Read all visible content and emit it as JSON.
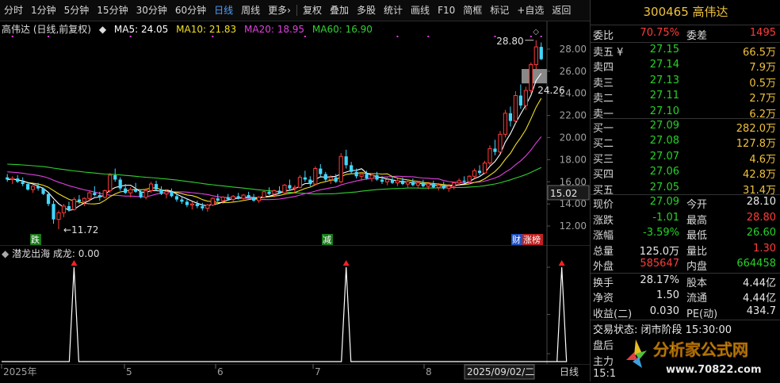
{
  "toolbar": {
    "items": [
      "分时",
      "1分钟",
      "5分钟",
      "15分钟",
      "30分钟",
      "60分钟",
      "日线",
      "周线",
      "更多",
      "复权",
      "叠加",
      "多股",
      "统计",
      "画线",
      "F10",
      "简框",
      "标记",
      "+自选",
      "返回"
    ],
    "active_index": 6
  },
  "legend": {
    "title": "高伟达 (日线,前复权)",
    "ma5": "MA5: 24.05",
    "ma10": "MA10: 21.83",
    "ma20": "MA20: 18.95",
    "ma60": "MA60: 16.90",
    "colors": {
      "ma5": "#ffffff",
      "ma10": "#f0e020",
      "ma20": "#e040e0",
      "ma60": "#30d030"
    }
  },
  "indicator_legend": {
    "name": "潜龙出海",
    "value": "成龙: 0.00"
  },
  "price_axis": {
    "ticks": [
      "28.00",
      "26.00",
      "24.00",
      "22.00",
      "20.00",
      "18.00",
      "16.00",
      "14.00",
      "12.00"
    ],
    "current": "15.02"
  },
  "annotations": {
    "high": "28.80",
    "high_flag": "24.26",
    "low": "←11.72",
    "tag_drop": "跌",
    "tag_reduce": "减",
    "tag_fin": "财",
    "tag_rank": "涨榜"
  },
  "time_axis": {
    "labels": [
      "2025年",
      "5",
      "6",
      "7",
      "8"
    ],
    "cursor_date": "2025/09/02/二",
    "period": "日线"
  },
  "chart_data": {
    "type": "candlestick",
    "title": "高伟达 (日线,前复权)",
    "ylim": [
      11,
      29.5
    ],
    "ohlc": [
      [
        16.4,
        16.7,
        16.0,
        16.2
      ],
      [
        16.2,
        16.5,
        15.8,
        16.3
      ],
      [
        16.3,
        16.6,
        15.9,
        16.0
      ],
      [
        16.0,
        16.4,
        15.6,
        15.8
      ],
      [
        15.8,
        16.0,
        15.2,
        15.3
      ],
      [
        15.3,
        15.7,
        15.0,
        15.6
      ],
      [
        15.6,
        15.9,
        15.2,
        15.4
      ],
      [
        15.4,
        15.5,
        14.8,
        14.9
      ],
      [
        14.9,
        15.0,
        13.8,
        14.0
      ],
      [
        14.0,
        14.3,
        12.2,
        12.6
      ],
      [
        12.6,
        13.4,
        11.72,
        13.2
      ],
      [
        13.2,
        14.0,
        12.8,
        13.8
      ],
      [
        13.8,
        14.2,
        13.3,
        13.5
      ],
      [
        13.5,
        14.6,
        13.4,
        14.4
      ],
      [
        14.4,
        14.8,
        14.0,
        14.2
      ],
      [
        14.2,
        14.6,
        13.8,
        14.5
      ],
      [
        14.5,
        15.2,
        14.2,
        15.0
      ],
      [
        15.0,
        15.6,
        14.7,
        14.8
      ],
      [
        14.8,
        15.1,
        14.3,
        14.6
      ],
      [
        14.6,
        15.3,
        14.5,
        15.2
      ],
      [
        15.2,
        16.8,
        15.0,
        16.6
      ],
      [
        16.6,
        17.2,
        16.0,
        16.2
      ],
      [
        16.2,
        16.4,
        15.2,
        15.4
      ],
      [
        15.4,
        15.8,
        14.9,
        15.0
      ],
      [
        15.0,
        15.5,
        14.6,
        15.3
      ],
      [
        15.3,
        15.9,
        15.0,
        15.1
      ],
      [
        15.1,
        15.3,
        14.5,
        14.6
      ],
      [
        14.6,
        15.4,
        14.4,
        15.2
      ],
      [
        15.2,
        16.0,
        15.0,
        15.8
      ],
      [
        15.8,
        16.1,
        15.2,
        15.3
      ],
      [
        15.3,
        15.6,
        14.8,
        14.9
      ],
      [
        14.9,
        15.3,
        14.5,
        15.1
      ],
      [
        15.1,
        15.4,
        14.6,
        14.7
      ],
      [
        14.7,
        15.0,
        14.2,
        14.4
      ],
      [
        14.4,
        14.7,
        14.0,
        14.2
      ],
      [
        14.2,
        14.5,
        13.7,
        13.9
      ],
      [
        13.9,
        14.2,
        13.5,
        14.0
      ],
      [
        14.0,
        14.3,
        13.6,
        13.8
      ],
      [
        13.8,
        14.1,
        13.4,
        13.6
      ],
      [
        13.6,
        14.0,
        13.3,
        13.9
      ],
      [
        13.9,
        14.6,
        13.8,
        14.5
      ],
      [
        14.5,
        14.9,
        14.2,
        14.3
      ],
      [
        14.3,
        14.7,
        14.0,
        14.6
      ],
      [
        14.6,
        14.9,
        14.3,
        14.4
      ],
      [
        14.4,
        14.8,
        14.2,
        14.7
      ],
      [
        14.7,
        15.0,
        14.4,
        14.5
      ],
      [
        14.5,
        14.9,
        14.3,
        14.8
      ],
      [
        14.8,
        15.1,
        14.5,
        14.6
      ],
      [
        14.6,
        14.9,
        14.2,
        14.3
      ],
      [
        14.3,
        14.7,
        14.1,
        14.6
      ],
      [
        14.6,
        15.2,
        14.5,
        15.1
      ],
      [
        15.1,
        15.5,
        14.8,
        14.9
      ],
      [
        14.9,
        15.3,
        14.6,
        15.2
      ],
      [
        15.2,
        15.6,
        14.9,
        15.0
      ],
      [
        15.0,
        15.8,
        14.9,
        15.7
      ],
      [
        15.7,
        16.2,
        15.3,
        15.4
      ],
      [
        15.4,
        15.7,
        15.0,
        15.5
      ],
      [
        15.5,
        16.6,
        15.4,
        16.4
      ],
      [
        16.4,
        17.0,
        16.0,
        16.2
      ],
      [
        16.2,
        16.5,
        15.6,
        15.8
      ],
      [
        15.8,
        17.4,
        15.7,
        17.2
      ],
      [
        17.2,
        17.6,
        16.5,
        16.7
      ],
      [
        16.7,
        16.9,
        16.0,
        16.2
      ],
      [
        16.2,
        16.6,
        15.8,
        16.4
      ],
      [
        16.4,
        16.7,
        15.9,
        16.0
      ],
      [
        16.0,
        18.6,
        15.9,
        18.3
      ],
      [
        18.3,
        18.9,
        17.2,
        17.5
      ],
      [
        17.5,
        17.8,
        16.7,
        16.9
      ],
      [
        16.9,
        17.2,
        16.3,
        16.5
      ],
      [
        16.5,
        16.9,
        16.1,
        16.7
      ],
      [
        16.7,
        17.0,
        16.2,
        16.3
      ],
      [
        16.3,
        16.8,
        16.0,
        16.6
      ],
      [
        16.6,
        16.9,
        16.1,
        16.2
      ],
      [
        16.2,
        16.5,
        15.8,
        16.0
      ],
      [
        16.0,
        16.4,
        15.7,
        16.2
      ],
      [
        16.2,
        16.5,
        15.8,
        15.9
      ],
      [
        15.9,
        16.3,
        15.6,
        16.1
      ],
      [
        16.1,
        16.4,
        15.7,
        15.8
      ],
      [
        15.8,
        16.2,
        15.5,
        16.0
      ],
      [
        16.0,
        16.3,
        15.6,
        15.7
      ],
      [
        15.7,
        16.1,
        15.4,
        15.9
      ],
      [
        15.9,
        16.2,
        15.5,
        15.6
      ],
      [
        15.6,
        16.0,
        15.3,
        15.8
      ],
      [
        15.8,
        16.1,
        15.4,
        15.5
      ],
      [
        15.5,
        15.9,
        15.2,
        15.7
      ],
      [
        15.7,
        16.0,
        15.3,
        15.4
      ],
      [
        15.4,
        15.8,
        15.1,
        15.6
      ],
      [
        15.6,
        16.0,
        15.3,
        15.9
      ],
      [
        15.9,
        16.3,
        15.6,
        16.1
      ],
      [
        16.1,
        16.5,
        15.8,
        16.0
      ],
      [
        16.0,
        16.6,
        15.8,
        16.5
      ],
      [
        16.5,
        17.2,
        16.3,
        17.0
      ],
      [
        17.0,
        17.5,
        16.6,
        16.8
      ],
      [
        16.8,
        17.9,
        16.7,
        17.7
      ],
      [
        17.7,
        19.3,
        17.5,
        19.0
      ],
      [
        19.0,
        19.8,
        18.4,
        18.7
      ],
      [
        18.7,
        20.6,
        18.6,
        20.3
      ],
      [
        20.3,
        22.5,
        20.0,
        22.2
      ],
      [
        22.2,
        22.8,
        21.0,
        21.5
      ],
      [
        21.5,
        24.2,
        21.3,
        23.8
      ],
      [
        23.8,
        24.8,
        22.6,
        22.9
      ],
      [
        22.9,
        24.6,
        22.5,
        24.26
      ],
      [
        24.26,
        26.8,
        24.0,
        26.6
      ],
      [
        26.6,
        28.8,
        26.2,
        28.2
      ],
      [
        28.2,
        28.6,
        27.0,
        27.09
      ]
    ],
    "ma5": 24.05,
    "ma10": 21.83,
    "ma20": 18.95,
    "ma60": 16.9,
    "indicator": {
      "name": "潜龙出海",
      "series_name": "成龙",
      "signals_at": [
        13,
        66,
        108
      ]
    }
  },
  "quote": {
    "code_name": "300465 高伟达",
    "webi": {
      "label": "委比",
      "value": "70.75%",
      "label2": "委差",
      "value2": "1495"
    },
    "sell": [
      {
        "label": "卖五",
        "price": "27.15",
        "vol": "66.5万",
        "flag": "¥"
      },
      {
        "label": "卖四",
        "price": "27.14",
        "vol": "7.9万"
      },
      {
        "label": "卖三",
        "price": "27.13",
        "vol": "0.5万"
      },
      {
        "label": "卖二",
        "price": "27.11",
        "vol": "2.7万"
      },
      {
        "label": "卖一",
        "price": "27.10",
        "vol": "6.2万"
      }
    ],
    "buy": [
      {
        "label": "买一",
        "price": "27.09",
        "vol": "282.0万"
      },
      {
        "label": "买二",
        "price": "27.08",
        "vol": "127.8万"
      },
      {
        "label": "买三",
        "price": "27.07",
        "vol": "4.6万"
      },
      {
        "label": "买四",
        "price": "27.06",
        "vol": "42.8万"
      },
      {
        "label": "买五",
        "price": "27.05",
        "vol": "31.4万"
      }
    ],
    "stats": [
      {
        "l1": "现价",
        "v1": "27.09",
        "c1": "green",
        "l2": "今开",
        "v2": "28.10",
        "c2": "white"
      },
      {
        "l1": "涨跌",
        "v1": "-1.01",
        "c1": "green",
        "l2": "最高",
        "v2": "28.80",
        "c2": "red"
      },
      {
        "l1": "涨幅",
        "v1": "-3.59%",
        "c1": "green",
        "l2": "最低",
        "v2": "26.60",
        "c2": "green"
      },
      {
        "l1": "总量",
        "v1": "125.0万",
        "c1": "white",
        "l2": "量比",
        "v2": "1.30",
        "c2": "red"
      },
      {
        "l1": "外盘",
        "v1": "585647",
        "c1": "red",
        "l2": "内盘",
        "v2": "664458",
        "c2": "green"
      }
    ],
    "stats2": [
      {
        "l1": "换手",
        "v1": "28.17%",
        "l2": "股本",
        "v2": "4.44亿"
      },
      {
        "l1": "净资",
        "v1": "1.50",
        "l2": "流通",
        "v2": "4.44亿"
      },
      {
        "l1": "收益(二)",
        "v1": "0.030",
        "l2": "PE(动)",
        "v2": "434.7"
      }
    ],
    "status": "交易状态: 闭市阶段 15:30:00",
    "after_hours": "盘后",
    "main_force": "主力",
    "time_cut": "15:1"
  },
  "logo": {
    "text": "分析家公式网",
    "url_text": "www.70822.com"
  }
}
